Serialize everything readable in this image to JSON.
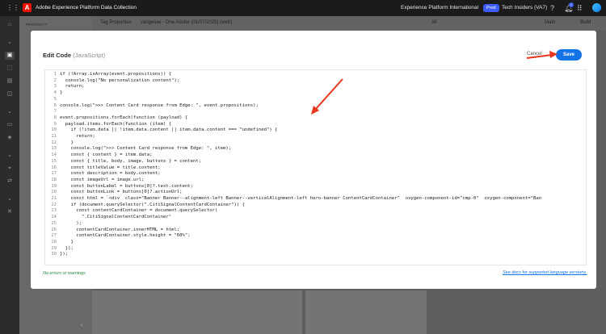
{
  "topbar": {
    "app_title": "Adobe Experience Platform Data Collection",
    "org_name": "Experience Platform International",
    "env_badge": "Prod",
    "sandbox": "Tech Insiders (VA7)",
    "notification_count": "1"
  },
  "background": {
    "property_label": "PROPERTY",
    "tag_properties": "Tag Properties",
    "property_name": "vangeluw - One Adobe (01/07/2025) (web)",
    "filter_all": "All",
    "branch": "Main",
    "build": "Build"
  },
  "dialog": {
    "title": "Edit Code",
    "title_lang": "(JavaScript)",
    "cancel_label": "Cancel",
    "save_label": "Save",
    "status": "No errors or warnings",
    "docs_link": "See docs for supported language versions."
  },
  "code_lines": [
    {
      "n": "1",
      "t": "if (!Array.isArray(event.propositions)) {"
    },
    {
      "n": "2",
      "t": "  console.log(\"No personalization content\");"
    },
    {
      "n": "3",
      "t": "  return;"
    },
    {
      "n": "4",
      "t": "}"
    },
    {
      "n": "5",
      "t": ""
    },
    {
      "n": "6",
      "t": "console.log(\">>> Content Card response from Edge: \", event.propositions);"
    },
    {
      "n": "7",
      "t": ""
    },
    {
      "n": "8",
      "t": "event.propositions.forEach(function (payload) {"
    },
    {
      "n": "9",
      "t": "  payload.items.forEach(function (item) {"
    },
    {
      "n": "10",
      "t": "    if (!item.data || !item.data.content || item.data.content === \"undefined\") {"
    },
    {
      "n": "11",
      "t": "      return;"
    },
    {
      "n": "12",
      "t": "    }"
    },
    {
      "n": "13",
      "t": "    console.log(\">>> Content Card response from Edge: \", item);"
    },
    {
      "n": "14",
      "t": "    const { content } = item.data;"
    },
    {
      "n": "15",
      "t": "    const { title, body, image, buttons } = content;"
    },
    {
      "n": "16",
      "t": "    const titleValue = title.content;"
    },
    {
      "n": "17",
      "t": "    const description = body.content;"
    },
    {
      "n": "18",
      "t": "    const imageUrl = image.url;"
    },
    {
      "n": "19",
      "t": "    const buttonLabel = buttons[0]?.text.content;"
    },
    {
      "n": "20",
      "t": "    const buttonLink = buttons[0]?.actionUrl;"
    },
    {
      "n": "21",
      "t": "    const html = `<div  class=\"Banner Banner--alignment-left Banner--verticalAlignment-left hero-banner ContentCardContainer\"  oxygen-component-id=\"cmp-0\"  oxygen-component=\"Ban"
    },
    {
      "n": "22",
      "t": "    if (document.querySelector(\".CitiSignalContentCardContainer\")) {"
    },
    {
      "n": "23",
      "t": "      const contentCardContainer = document.querySelector("
    },
    {
      "n": "24",
      "t": "        \".CitiSignalContentCardContainer\""
    },
    {
      "n": "25",
      "t": "      );"
    },
    {
      "n": "26",
      "t": "      contentCardContainer.innerHTML = html;"
    },
    {
      "n": "27",
      "t": "      contentCardContainer.style.height = \"60%\";"
    },
    {
      "n": "28",
      "t": "    }"
    },
    {
      "n": "29",
      "t": "  });"
    },
    {
      "n": "30",
      "t": "});"
    }
  ],
  "colors": {
    "accent": "#1473e6",
    "annotation_arrow": "#e8361c",
    "status_ok": "#2b8a3e"
  }
}
